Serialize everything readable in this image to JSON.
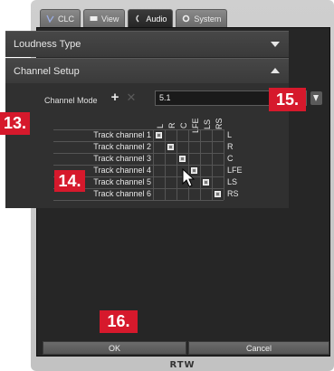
{
  "tabs": [
    {
      "label": "CLC",
      "icon": "clc-icon",
      "active": false
    },
    {
      "label": "View",
      "icon": "view-icon",
      "active": false
    },
    {
      "label": "Audio",
      "icon": "audio-icon",
      "active": true
    },
    {
      "label": "System",
      "icon": "gear-icon",
      "active": false
    }
  ],
  "loudness_type": {
    "title": "Loudness Type"
  },
  "channel_setup": {
    "title": "Channel Setup",
    "mode_label": "Channel Mode",
    "mode_value": "5.1",
    "columns": [
      "L",
      "R",
      "C",
      "LFE",
      "LS",
      "RS"
    ],
    "rows": [
      {
        "label": "Track channel 1",
        "output": "L"
      },
      {
        "label": "Track channel 2",
        "output": "R"
      },
      {
        "label": "Track channel 3",
        "output": "C"
      },
      {
        "label": "Track channel 4",
        "output": "LFE"
      },
      {
        "label": "Track channel 5",
        "output": "LS"
      },
      {
        "label": "Track channel 6",
        "output": "RS"
      }
    ]
  },
  "callouts": {
    "c13": "13.",
    "c14": "14.",
    "c15": "15.",
    "c16": "16."
  },
  "buttons": {
    "ok": "OK",
    "cancel": "Cancel"
  },
  "brand": "RTW",
  "colors": {
    "callout": "#d6192c",
    "panel": "#262626",
    "accent_text": "#e6e6e6"
  }
}
